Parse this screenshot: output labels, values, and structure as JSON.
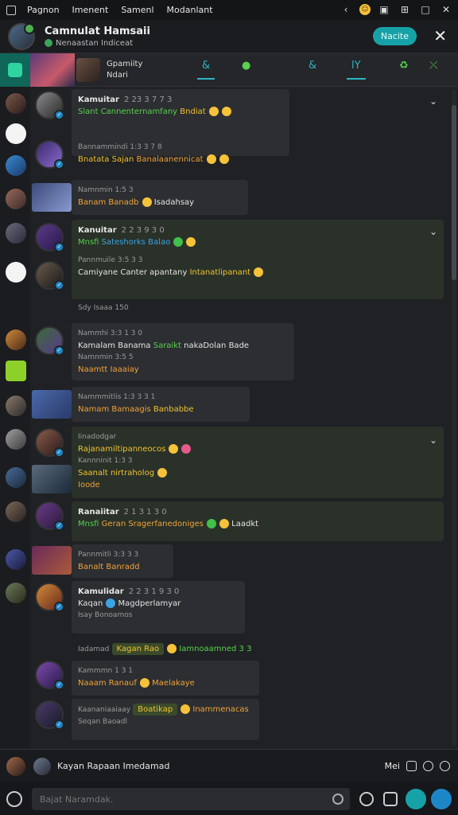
{
  "menubar": {
    "items": [
      "Pagnon",
      "Imenent",
      "Samenl",
      "Modanlant"
    ]
  },
  "header": {
    "title": "Camnulat Hamsaii",
    "subtitle": "Nenaastan Indiceat",
    "action_label": "Nacite",
    "close": "✕"
  },
  "chat_header": {
    "name": "Gpamiity",
    "subtitle": "Ndari",
    "tabs": [
      "&",
      "●",
      "&",
      "lΥ",
      "♻",
      "⤬"
    ]
  },
  "messages": [
    {
      "name": "Kamuitar",
      "time": "2 23 3 7 7 3",
      "text_a": "Slant Cannenternamfany",
      "text_b": "Bndiat"
    },
    {
      "meta": "Bannammindi 1:3 3 7 8",
      "text_a": "Bnatata Sajan",
      "text_b": "Banalaanennicat"
    },
    {
      "meta": "Namnmin 1:5 3",
      "text_a": "Banam Banadb",
      "text_b": "Isadahsay"
    },
    {
      "name": "Kanuitar",
      "time": "2 2 3 9 3 0",
      "text_a": "Mnsfi",
      "text_b": "Sateshorks Balao"
    },
    {
      "meta": "Pannmuile 3:5 3 3",
      "text_a": "Camiyane Canter apantany",
      "text_b": "Intanatlipanant",
      "sub": "Sdy  Isaaa 150"
    },
    {
      "meta": "Nammhi 3:3 1 3 0",
      "text_a": "Kamalam Banama",
      "text_b": "Saraikt",
      "text_c": "nakaDolan Bade",
      "sub_meta": "Namnmin 3:5 5",
      "sub_text": "Naamtt Iaaaiay"
    },
    {
      "meta": "Nammmitlis 1:3 3 3 1",
      "text_a": "Namam Bamaagis",
      "text_b": "Banbabbe"
    },
    {
      "meta": "Iinadodgar",
      "text_a": "Rajanamiltipanneocos",
      "sub_meta": "Kannninit 1:3 3",
      "text_b": "Saanalt nirtraholog",
      "sub_text": "Ioode"
    },
    {
      "name": "Ranaiitar",
      "time": "2 1 3 1 3 0",
      "text_a": "Mnsfi",
      "text_b": "Geran Sragerfanedoniges",
      "text_c": "Laadkt"
    },
    {
      "meta": "Pannmitli 3:3 3 3",
      "text_a": "Banalt Banradd"
    },
    {
      "name": "Kamulidar",
      "time": "2 2 3 1 9 3 0",
      "text_a": "Kaqan",
      "text_b": "Magdperlamyar",
      "sub": "Isay  Bonoamos"
    },
    {
      "meta": "Iadamad",
      "text_a": "Kagan Rao",
      "text_b": "Iamnoaamned 3 3"
    },
    {
      "meta": "Kammmn 1 3 1",
      "text_a": "Naaam Ranauf",
      "text_b": "Maelakaye"
    },
    {
      "meta": "Kaananiaaiaay",
      "text_a": "Boatikap",
      "text_b": "Inammenacas",
      "sub": "Seqan  Baoadl"
    }
  ],
  "status": {
    "text": "Kayan Rapaan Imedamad",
    "right_label": "Mei"
  },
  "composer": {
    "placeholder": "Bajat Naramdak."
  }
}
